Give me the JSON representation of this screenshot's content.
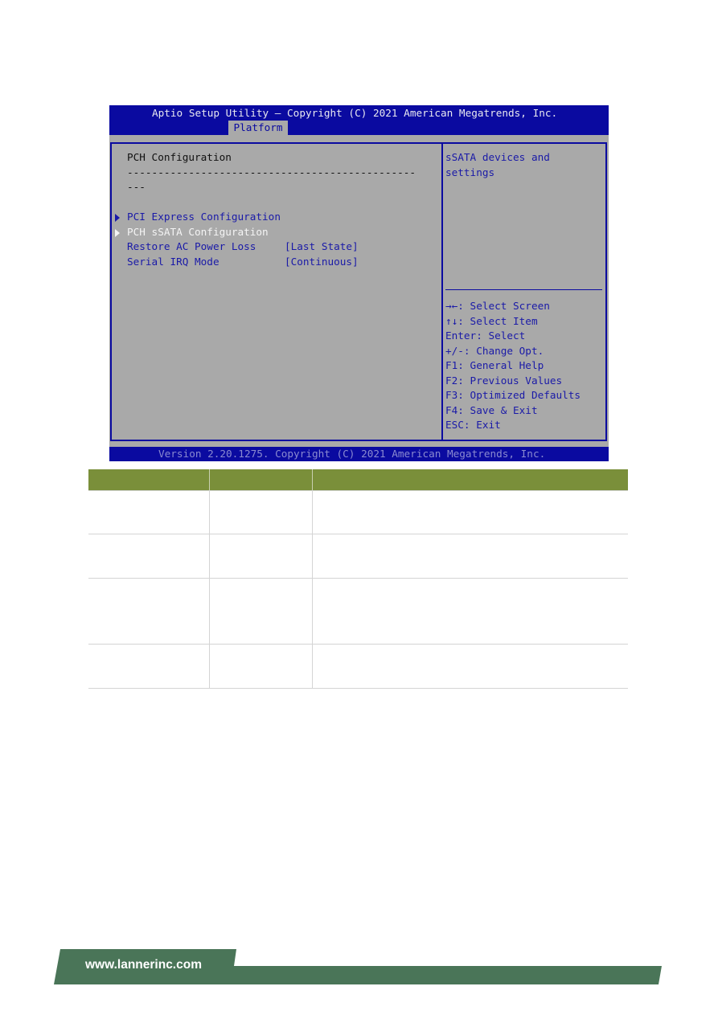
{
  "bios": {
    "title": "Aptio Setup Utility – Copyright (C) 2021 American Megatrends, Inc.",
    "active_tab": "Platform",
    "page_heading": "PCH Configuration",
    "separator_line1": "-----------------------------------------------",
    "separator_line2": "---",
    "items": [
      {
        "label": "PCI Express Configuration",
        "type": "submenu"
      },
      {
        "label": "PCH sSATA Configuration",
        "type": "submenu",
        "selected": true
      },
      {
        "label": "Restore AC Power Loss",
        "value": "[Last State]"
      },
      {
        "label": "Serial IRQ Mode",
        "value": "[Continuous]"
      }
    ],
    "help_text": [
      "sSATA devices and",
      "settings"
    ],
    "key_help": [
      "→←: Select Screen",
      "↑↓: Select Item",
      "Enter: Select",
      "+/-: Change Opt.",
      "F1: General Help",
      "F2: Previous Values",
      "F3: Optimized Defaults",
      "F4: Save & Exit",
      "ESC: Exit"
    ],
    "version": "Version 2.20.1275. Copyright (C) 2021 American Megatrends, Inc.",
    "colors": {
      "blue": "#0a0aa0",
      "gray": "#a9a9a9",
      "selected": "#f4f4f4"
    }
  },
  "footer": {
    "url": "www.lannerinc.com",
    "color": "#4a7558"
  },
  "table": {
    "header_color": "#7a8f3a",
    "rows": 4,
    "columns": 3
  }
}
